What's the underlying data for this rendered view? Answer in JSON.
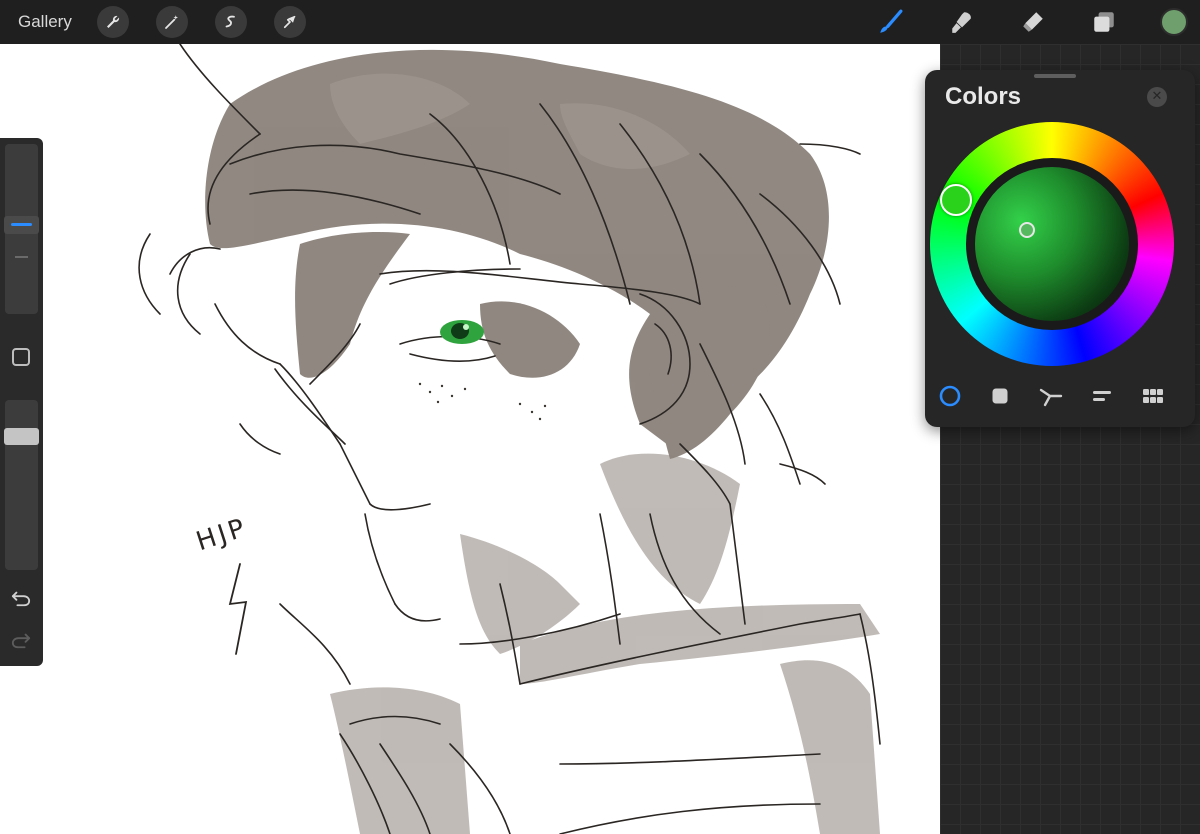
{
  "topbar": {
    "gallery_label": "Gallery",
    "left_tools": [
      {
        "name": "wrench-icon",
        "action": "Actions"
      },
      {
        "name": "magic-wand-icon",
        "action": "Adjustments"
      },
      {
        "name": "selection-icon",
        "action": "Selection"
      },
      {
        "name": "arrow-cursor-icon",
        "action": "Transform"
      }
    ],
    "right_tools": [
      {
        "name": "brush-icon",
        "active": true
      },
      {
        "name": "smudge-icon",
        "active": false
      },
      {
        "name": "eraser-icon",
        "active": false
      },
      {
        "name": "layers-icon",
        "active": false
      }
    ],
    "current_color": "#6e9f6c"
  },
  "sidebar": {
    "undo_icon": "undo-icon",
    "redo_icon": "redo-icon"
  },
  "colors_panel": {
    "title": "Colors",
    "close_icon": "close-icon",
    "selected_hue_color": "#2bd21c",
    "modes": [
      {
        "name": "disc-mode-icon",
        "active": true
      },
      {
        "name": "classic-mode-icon",
        "active": false
      },
      {
        "name": "harmony-mode-icon",
        "active": false
      },
      {
        "name": "value-mode-icon",
        "active": false
      },
      {
        "name": "palettes-mode-icon",
        "active": false
      }
    ]
  },
  "canvas": {
    "signature": "HJP"
  },
  "colors": {
    "accent": "#2a8cff",
    "topbar_bg": "#1f1f1f",
    "panel_bg": "#262626",
    "eye_green": "#2fa33d"
  }
}
